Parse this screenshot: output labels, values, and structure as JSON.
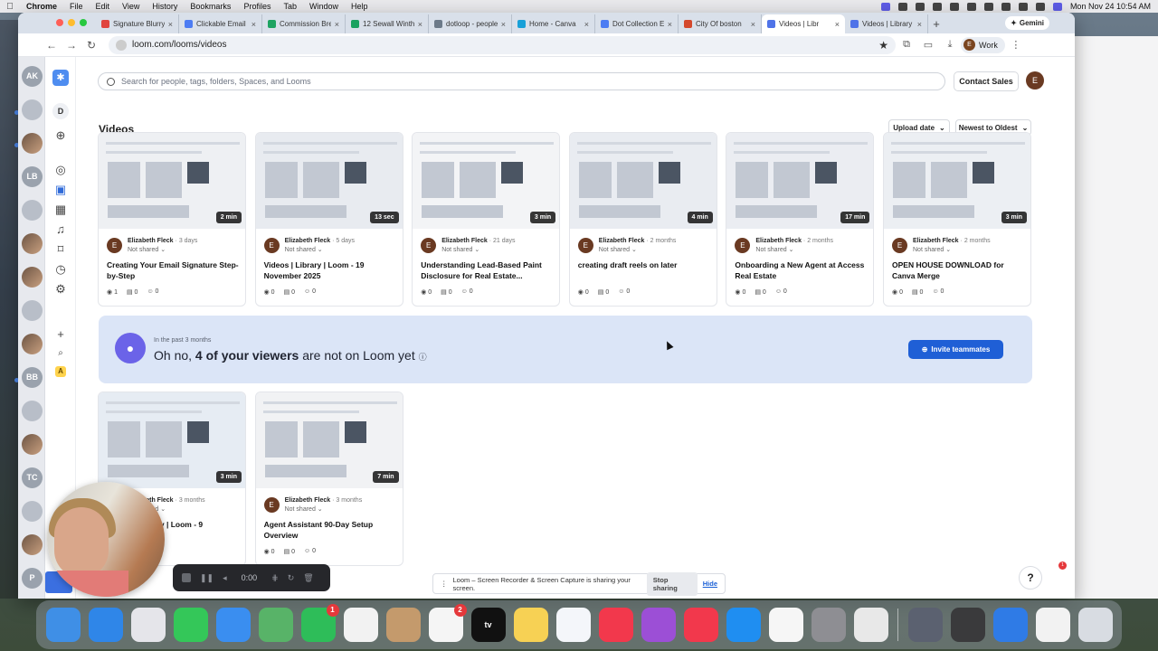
{
  "menubar": {
    "app": "Chrome",
    "items": [
      "File",
      "Edit",
      "View",
      "History",
      "Bookmarks",
      "Profiles",
      "Tab",
      "Window",
      "Help"
    ],
    "clock": "Mon Nov 24  10:54 AM"
  },
  "tabs": [
    {
      "label": "Signature Blurry",
      "color": "#e0443e"
    },
    {
      "label": "Clickable Email",
      "color": "#4c7cf3"
    },
    {
      "label": "Commission Bre",
      "color": "#1ea362"
    },
    {
      "label": "12 Sewall Winthr",
      "color": "#1aa260"
    },
    {
      "label": "dotloop - people",
      "color": "#6c7a89"
    },
    {
      "label": "Home - Canva",
      "color": "#18a0d8"
    },
    {
      "label": "Dot Collection E",
      "color": "#4c7cf3"
    },
    {
      "label": "City Of boston",
      "color": "#d4482c"
    },
    {
      "label": "Videos | Libr",
      "color": "#4f73e8",
      "active": true
    },
    {
      "label": "Videos | Library",
      "color": "#4f73e8"
    }
  ],
  "gemini_label": "Gemini",
  "url": "loom.com/looms/videos",
  "profile_label": "Work",
  "profile_initial": "E",
  "rail_accounts": [
    "AK",
    "",
    "",
    "LB",
    "",
    "",
    "",
    "",
    "",
    "BB",
    "",
    "",
    "TC",
    "",
    "",
    "P"
  ],
  "rail_d": "D",
  "rail_a": "A",
  "search": {
    "placeholder": "Search for people, tags, folders, Spaces, and Looms"
  },
  "contact_sales": "Contact Sales",
  "user_initial": "E",
  "page_title": "Videos",
  "sort": {
    "upload": "Upload date",
    "order": "Newest to Oldest"
  },
  "videos": [
    {
      "duration": "2 min",
      "author": "Elizabeth Fleck",
      "when": "3 days",
      "shared": "Not shared",
      "title": "Creating Your Email Signature Step-by-Step",
      "views": "1",
      "comments": "0",
      "reactions": "0"
    },
    {
      "duration": "13 sec",
      "author": "Elizabeth Fleck",
      "when": "5 days",
      "shared": "Not shared",
      "title": "Videos | Library | Loom - 19 November 2025",
      "views": "0",
      "comments": "0",
      "reactions": "0"
    },
    {
      "duration": "3 min",
      "author": "Elizabeth Fleck",
      "when": "21 days",
      "shared": "Not shared",
      "title": "Understanding Lead-Based Paint Disclosure for Real Estate...",
      "views": "0",
      "comments": "0",
      "reactions": "0"
    },
    {
      "duration": "4 min",
      "author": "Elizabeth Fleck",
      "when": "2 months",
      "shared": "Not shared",
      "title": "creating draft reels on later",
      "views": "0",
      "comments": "0",
      "reactions": "0"
    },
    {
      "duration": "17 min",
      "author": "Elizabeth Fleck",
      "when": "2 months",
      "shared": "Not shared",
      "title": "Onboarding a New Agent at Access Real Estate",
      "views": "0",
      "comments": "0",
      "reactions": "0"
    },
    {
      "duration": "3 min",
      "author": "Elizabeth Fleck",
      "when": "2 months",
      "shared": "Not shared",
      "title": "OPEN HOUSE DOWNLOAD for Canva Merge",
      "views": "0",
      "comments": "0",
      "reactions": "0"
    },
    {
      "duration": "3 min",
      "author": "Elizabeth Fleck",
      "when": "3 months",
      "shared": "Not shared",
      "title": "Videos | Library | Loom - 9",
      "views": "0",
      "comments": "0",
      "reactions": "0"
    },
    {
      "duration": "7 min",
      "author": "Elizabeth Fleck",
      "when": "3 months",
      "shared": "Not shared",
      "title": "Agent Assistant 90-Day Setup Overview",
      "views": "0",
      "comments": "0",
      "reactions": "0"
    }
  ],
  "banner": {
    "small": "In the past 3 months",
    "prefix": "Oh no, ",
    "highlight": "4 of your viewers",
    "suffix": " are not on Loom yet",
    "invite": "Invite teammates"
  },
  "recorder": {
    "time": "0:00"
  },
  "share_notice": {
    "text": "Loom – Screen Recorder & Screen Capture is sharing your screen.",
    "stop": "Stop sharing",
    "hide": "Hide"
  },
  "help": "?",
  "dock": {
    "apps": [
      {
        "name": "finder",
        "color": "#3f8fe6"
      },
      {
        "name": "safari",
        "color": "#2f86e8"
      },
      {
        "name": "launchpad",
        "color": "#e5e5ea"
      },
      {
        "name": "messages",
        "color": "#34c759"
      },
      {
        "name": "mail",
        "color": "#3a8ef0"
      },
      {
        "name": "maps",
        "color": "#58b368"
      },
      {
        "name": "facetime",
        "color": "#2ebd59",
        "badge": "1"
      },
      {
        "name": "photos",
        "color": "#f2f2f2"
      },
      {
        "name": "contacts",
        "color": "#c49a6c"
      },
      {
        "name": "reminders",
        "color": "#f5f5f5",
        "badge": "2"
      },
      {
        "name": "tv",
        "color": "#111111",
        "text": "tv"
      },
      {
        "name": "notes",
        "color": "#f7d154"
      },
      {
        "name": "freeform",
        "color": "#f4f6fa"
      },
      {
        "name": "music",
        "color": "#f2384c"
      },
      {
        "name": "podcasts",
        "color": "#9c4fd6"
      },
      {
        "name": "news",
        "color": "#f2384c"
      },
      {
        "name": "app-store",
        "color": "#1f8ef1"
      },
      {
        "name": "keynote",
        "color": "#f6f6f6"
      },
      {
        "name": "system-settings",
        "color": "#8e8e93"
      },
      {
        "name": "chrome",
        "color": "#e8e8e8"
      }
    ],
    "right": [
      {
        "name": "printer",
        "color": "#5b6170"
      },
      {
        "name": "calculator",
        "color": "#3a3a3c"
      },
      {
        "name": "preview",
        "color": "#2f7be6"
      },
      {
        "name": "document",
        "color": "#f2f2f2"
      },
      {
        "name": "trash",
        "color": "#d8dce2"
      }
    ]
  }
}
